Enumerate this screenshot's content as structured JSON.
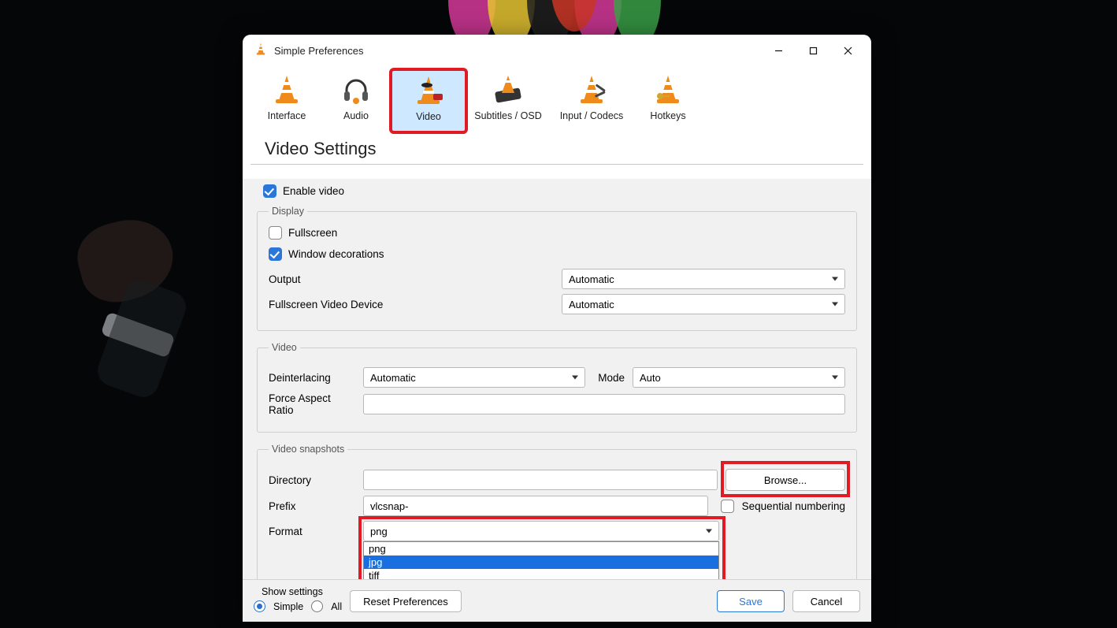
{
  "window": {
    "title": "Simple Preferences"
  },
  "categories": {
    "interface": "Interface",
    "audio": "Audio",
    "video": "Video",
    "subtitles": "Subtitles / OSD",
    "input": "Input / Codecs",
    "hotkeys": "Hotkeys"
  },
  "page": {
    "title": "Video Settings"
  },
  "enable_video": {
    "label": "Enable video",
    "checked": true
  },
  "display": {
    "legend": "Display",
    "fullscreen": {
      "label": "Fullscreen",
      "checked": false
    },
    "window_decorations": {
      "label": "Window decorations",
      "checked": true
    },
    "output": {
      "label": "Output",
      "value": "Automatic"
    },
    "fullscreen_device": {
      "label": "Fullscreen Video Device",
      "value": "Automatic"
    }
  },
  "video": {
    "legend": "Video",
    "deinterlacing": {
      "label": "Deinterlacing",
      "value": "Automatic"
    },
    "mode": {
      "label": "Mode",
      "value": "Auto"
    },
    "force_aspect": {
      "label": "Force Aspect Ratio",
      "value": ""
    }
  },
  "snapshots": {
    "legend": "Video snapshots",
    "directory": {
      "label": "Directory",
      "value": ""
    },
    "browse": "Browse...",
    "prefix": {
      "label": "Prefix",
      "value": "vlcsnap-"
    },
    "sequential": {
      "label": "Sequential numbering",
      "checked": false
    },
    "format": {
      "label": "Format",
      "value": "png",
      "options": [
        "png",
        "jpg",
        "tiff"
      ],
      "highlighted_option": "jpg"
    }
  },
  "footer": {
    "show_settings": "Show settings",
    "simple": "Simple",
    "all": "All",
    "reset": "Reset Preferences",
    "save": "Save",
    "cancel": "Cancel"
  }
}
